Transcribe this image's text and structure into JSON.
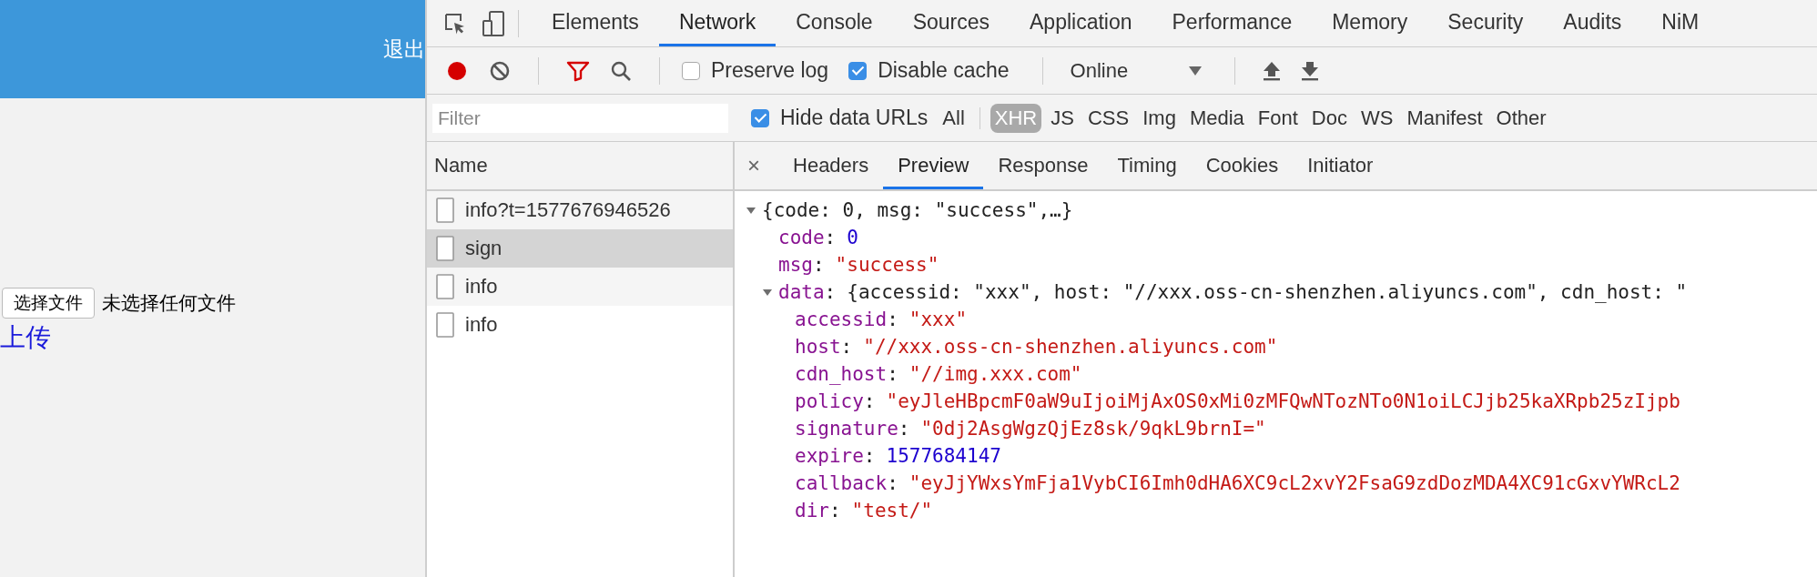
{
  "page": {
    "header_link": "退出",
    "file_button": "选择文件",
    "file_status": "未选择任何文件",
    "upload_link": "上传"
  },
  "devtools": {
    "tabs": [
      {
        "label": "Elements",
        "selected": false
      },
      {
        "label": "Network",
        "selected": true
      },
      {
        "label": "Console",
        "selected": false
      },
      {
        "label": "Sources",
        "selected": false
      },
      {
        "label": "Application",
        "selected": false
      },
      {
        "label": "Performance",
        "selected": false
      },
      {
        "label": "Memory",
        "selected": false
      },
      {
        "label": "Security",
        "selected": false
      },
      {
        "label": "Audits",
        "selected": false
      },
      {
        "label": "NiM",
        "selected": false
      }
    ],
    "toolbar": {
      "recording": true,
      "filter_active": true,
      "preserve_log": {
        "label": "Preserve log",
        "checked": false
      },
      "disable_cache": {
        "label": "Disable cache",
        "checked": true
      },
      "throttling": "Online"
    },
    "filter": {
      "placeholder": "Filter",
      "hide_data_urls": {
        "label": "Hide data URLs",
        "checked": true
      },
      "types": [
        {
          "label": "All",
          "selected": false
        },
        {
          "label": "XHR",
          "selected": true
        },
        {
          "label": "JS",
          "selected": false
        },
        {
          "label": "CSS",
          "selected": false
        },
        {
          "label": "Img",
          "selected": false
        },
        {
          "label": "Media",
          "selected": false
        },
        {
          "label": "Font",
          "selected": false
        },
        {
          "label": "Doc",
          "selected": false
        },
        {
          "label": "WS",
          "selected": false
        },
        {
          "label": "Manifest",
          "selected": false
        },
        {
          "label": "Other",
          "selected": false
        }
      ]
    },
    "name_column": "Name",
    "requests": [
      {
        "name": "info?t=1577676946526",
        "selected": false
      },
      {
        "name": "sign",
        "selected": true
      },
      {
        "name": "info",
        "selected": false
      },
      {
        "name": "info",
        "selected": false
      }
    ],
    "close": "×",
    "detail_tabs": [
      {
        "label": "Headers",
        "selected": false
      },
      {
        "label": "Preview",
        "selected": true
      },
      {
        "label": "Response",
        "selected": false
      },
      {
        "label": "Timing",
        "selected": false
      },
      {
        "label": "Cookies",
        "selected": false
      },
      {
        "label": "Initiator",
        "selected": false
      }
    ],
    "preview": {
      "kind": "object",
      "summary": "{code: 0, msg: \"success\",…}",
      "expanded": true,
      "children": [
        {
          "kind": "number",
          "key": "code",
          "colon": ":",
          "value": "0"
        },
        {
          "kind": "string",
          "key": "msg",
          "colon": ":",
          "value": "\"success\""
        },
        {
          "kind": "object",
          "key": "data",
          "colon": ":",
          "summary": "{accessid: \"xxx\", host: \"//xxx.oss-cn-shenzhen.aliyuncs.com\", cdn_host: \"",
          "expanded": true,
          "children": [
            {
              "kind": "string",
              "key": "accessid",
              "colon": ":",
              "value": "\"xxx\""
            },
            {
              "kind": "string",
              "key": "host",
              "colon": ":",
              "value": "\"//xxx.oss-cn-shenzhen.aliyuncs.com\""
            },
            {
              "kind": "string",
              "key": "cdn_host",
              "colon": ":",
              "value": "\"//img.xxx.com\""
            },
            {
              "kind": "string",
              "key": "policy",
              "colon": ":",
              "value": "\"eyJleHBpcmF0aW9uIjoiMjAxOS0xMi0zMFQwNTozNTo0N1oiLCJjb25kaXRpb25zIjpb"
            },
            {
              "kind": "string",
              "key": "signature",
              "colon": ":",
              "value": "\"0dj2AsgWgzQjEz8sk/9qkL9brnI=\""
            },
            {
              "kind": "number",
              "key": "expire",
              "colon": ":",
              "value": "1577684147"
            },
            {
              "kind": "string",
              "key": "callback",
              "colon": ":",
              "value": "\"eyJjYWxsYmFja1VybCI6Imh0dHA6XC9cL2xvY2FsaG9zdDozMDA4XC91cGxvYWRcL2"
            },
            {
              "kind": "string",
              "key": "dir",
              "colon": ":",
              "value": "\"test/\""
            }
          ]
        }
      ]
    }
  }
}
